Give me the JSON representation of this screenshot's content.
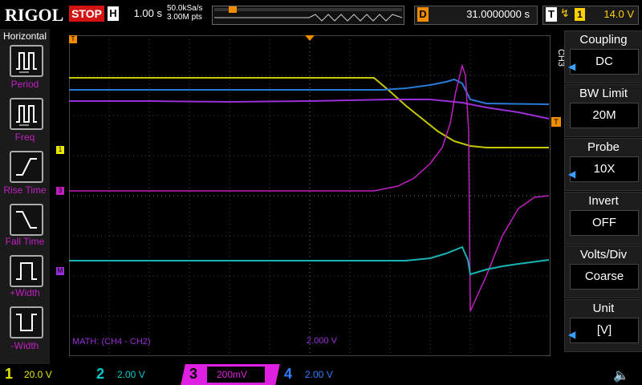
{
  "top": {
    "logo": "RIGOL",
    "status": "STOP",
    "timebase_label": "H",
    "timebase_value": "1.00 s",
    "sample_rate": "50.0kSa/s",
    "memory_depth": "3.00M pts",
    "delay_label": "D",
    "delay_value": "31.0000000 s",
    "trigger_label": "T",
    "trigger_channel": "1",
    "trigger_level": "14.0 V"
  },
  "left_menu": {
    "title": "Horizontal",
    "items": [
      {
        "label": "Period"
      },
      {
        "label": "Freq"
      },
      {
        "label": "Rise Time"
      },
      {
        "label": "Fall Time"
      },
      {
        "label": "+Width"
      },
      {
        "label": "-Width"
      }
    ]
  },
  "right_menu": {
    "channel": "CH3",
    "groups": [
      {
        "title": "Coupling",
        "value": "DC"
      },
      {
        "title": "BW Limit",
        "value": "20M"
      },
      {
        "title": "Probe",
        "value": "10X"
      },
      {
        "title": "Invert",
        "value": "OFF"
      },
      {
        "title": "Volts/Div",
        "value": "Coarse"
      },
      {
        "title": "Unit",
        "value": "[V]"
      }
    ]
  },
  "math": {
    "expression": "MATH: (CH4 - CH2)",
    "scale": "2.000 V"
  },
  "markers": {
    "ch1": "1",
    "ch3": "3",
    "math": "M",
    "trigger": "T"
  },
  "bottom": {
    "channels": [
      {
        "num": "1",
        "scale": "20.0 V",
        "color": "#e8e800"
      },
      {
        "num": "2",
        "scale": "2.00 V",
        "color": "#00c8c8"
      },
      {
        "num": "3",
        "scale": "200mV",
        "color": "#e020e0"
      },
      {
        "num": "4",
        "scale": "2.00 V",
        "color": "#2f7fff"
      }
    ]
  },
  "colors": {
    "ch1": "#c8c800",
    "ch2": "#18b4b4",
    "ch3": "#c020c0",
    "ch4": "#2a7ad8",
    "math": "#9b2fd8",
    "trigger": "#f08c00"
  }
}
